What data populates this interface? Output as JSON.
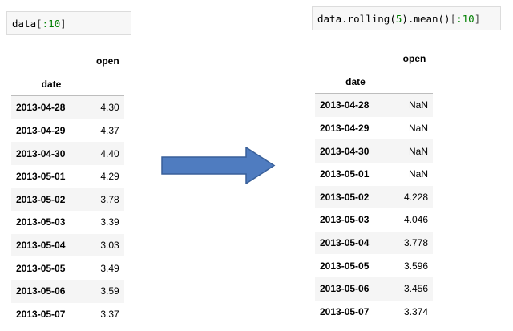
{
  "left_cell": {
    "var": "data",
    "open_bracket": "[",
    "slice": ":10",
    "close_bracket": "]"
  },
  "right_cell": {
    "var": "data",
    "method": ".rolling(",
    "window": "5",
    "tail": ").mean()",
    "open_bracket": "[",
    "slice": ":10",
    "close_bracket": "]"
  },
  "left_table": {
    "column": "open",
    "index_name": "date",
    "rows": [
      {
        "date": "2013-04-28",
        "open": "4.30"
      },
      {
        "date": "2013-04-29",
        "open": "4.37"
      },
      {
        "date": "2013-04-30",
        "open": "4.40"
      },
      {
        "date": "2013-05-01",
        "open": "4.29"
      },
      {
        "date": "2013-05-02",
        "open": "3.78"
      },
      {
        "date": "2013-05-03",
        "open": "3.39"
      },
      {
        "date": "2013-05-04",
        "open": "3.03"
      },
      {
        "date": "2013-05-05",
        "open": "3.49"
      },
      {
        "date": "2013-05-06",
        "open": "3.59"
      },
      {
        "date": "2013-05-07",
        "open": "3.37"
      }
    ]
  },
  "right_table": {
    "column": "open",
    "index_name": "date",
    "rows": [
      {
        "date": "2013-04-28",
        "open": "NaN"
      },
      {
        "date": "2013-04-29",
        "open": "NaN"
      },
      {
        "date": "2013-04-30",
        "open": "NaN"
      },
      {
        "date": "2013-05-01",
        "open": "NaN"
      },
      {
        "date": "2013-05-02",
        "open": "4.228"
      },
      {
        "date": "2013-05-03",
        "open": "4.046"
      },
      {
        "date": "2013-05-04",
        "open": "3.778"
      },
      {
        "date": "2013-05-05",
        "open": "3.596"
      },
      {
        "date": "2013-05-06",
        "open": "3.456"
      },
      {
        "date": "2013-05-07",
        "open": "3.374"
      }
    ]
  },
  "arrow": {
    "icon": "right-arrow-icon",
    "fill": "#4f7cc0",
    "stroke": "#385f99"
  }
}
